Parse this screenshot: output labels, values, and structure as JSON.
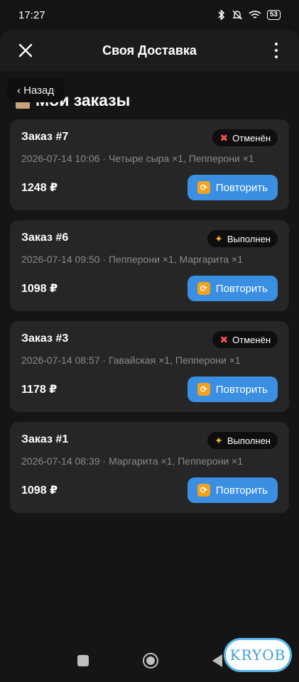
{
  "status_bar": {
    "time": "17:27",
    "battery": "53"
  },
  "app_bar": {
    "title": "Своя Доставка"
  },
  "page": {
    "back_label": "‹ Назад",
    "title": "Мои заказы"
  },
  "orders": [
    {
      "title": "Заказ #7",
      "status": "Отменён",
      "status_icon": "cross-icon",
      "meta": "2026-07-14 10:06 · Четыре сыра ×1, Пепперони ×1",
      "price": "1248 ₽",
      "repeat_label": "Повторить"
    },
    {
      "title": "Заказ #6",
      "status": "Выполнен",
      "status_icon": "party-icon",
      "meta": "2026-07-14 09:50 · Пепперони ×1, Маргарита ×1",
      "price": "1098 ₽",
      "repeat_label": "Повторить"
    },
    {
      "title": "Заказ #3",
      "status": "Отменён",
      "status_icon": "cross-icon",
      "meta": "2026-07-14 08:57 · Гавайская ×1, Пепперони ×1",
      "price": "1178 ₽",
      "repeat_label": "Повторить"
    },
    {
      "title": "Заказ #1",
      "status": "Выполнен",
      "status_icon": "party-icon",
      "meta": "2026-07-14 08:39 · Маргарита ×1, Пепперони ×1",
      "price": "1098 ₽",
      "repeat_label": "Повторить"
    }
  ],
  "watermark": "KRYOB",
  "colors": {
    "accent": "#3a8fe3",
    "card": "#262626",
    "background": "#151515"
  }
}
